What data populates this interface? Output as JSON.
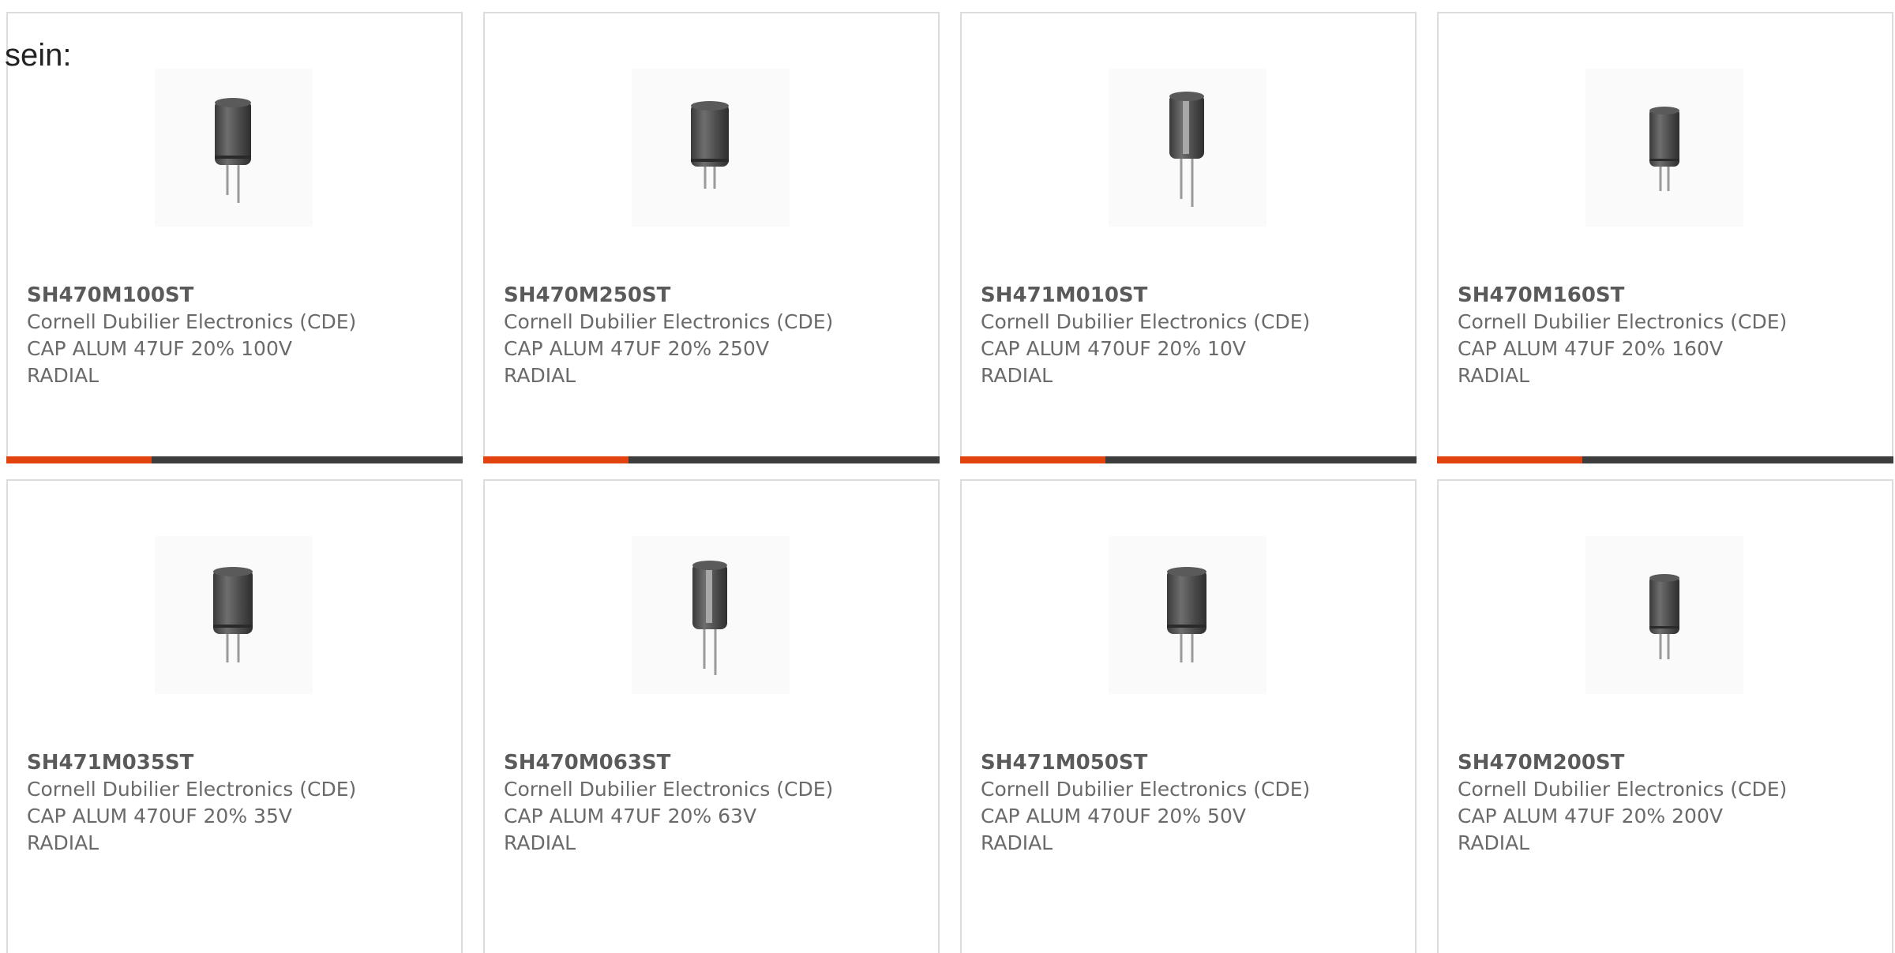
{
  "intro_text": "sein:",
  "colors": {
    "accent": "#e2420e",
    "bar": "#3d3d3d",
    "border": "#dcdcdc",
    "text": "#6a6a6a"
  },
  "products": [
    {
      "part_number": "SH470M100ST",
      "manufacturer": "Cornell Dubilier Electronics (CDE)",
      "description": "CAP ALUM 47UF 20% 100V",
      "package": "RADIAL",
      "image_icon": "radial-capacitor-icon"
    },
    {
      "part_number": "SH470M250ST",
      "manufacturer": "Cornell Dubilier Electronics (CDE)",
      "description": "CAP ALUM 47UF 20% 250V",
      "package": "RADIAL",
      "image_icon": "radial-capacitor-icon"
    },
    {
      "part_number": "SH471M010ST",
      "manufacturer": "Cornell Dubilier Electronics (CDE)",
      "description": "CAP ALUM 470UF 20% 10V",
      "package": "RADIAL",
      "image_icon": "radial-capacitor-icon"
    },
    {
      "part_number": "SH470M160ST",
      "manufacturer": "Cornell Dubilier Electronics (CDE)",
      "description": "CAP ALUM 47UF 20% 160V",
      "package": "RADIAL",
      "image_icon": "radial-capacitor-icon"
    },
    {
      "part_number": "SH471M035ST",
      "manufacturer": "Cornell Dubilier Electronics (CDE)",
      "description": "CAP ALUM 470UF 20% 35V",
      "package": "RADIAL",
      "image_icon": "radial-capacitor-icon"
    },
    {
      "part_number": "SH470M063ST",
      "manufacturer": "Cornell Dubilier Electronics (CDE)",
      "description": "CAP ALUM 47UF 20% 63V",
      "package": "RADIAL",
      "image_icon": "radial-capacitor-icon"
    },
    {
      "part_number": "SH471M050ST",
      "manufacturer": "Cornell Dubilier Electronics (CDE)",
      "description": "CAP ALUM 470UF 20% 50V",
      "package": "RADIAL",
      "image_icon": "radial-capacitor-icon"
    },
    {
      "part_number": "SH470M200ST",
      "manufacturer": "Cornell Dubilier Electronics (CDE)",
      "description": "CAP ALUM 47UF 20% 200V",
      "package": "RADIAL",
      "image_icon": "radial-capacitor-icon"
    }
  ]
}
